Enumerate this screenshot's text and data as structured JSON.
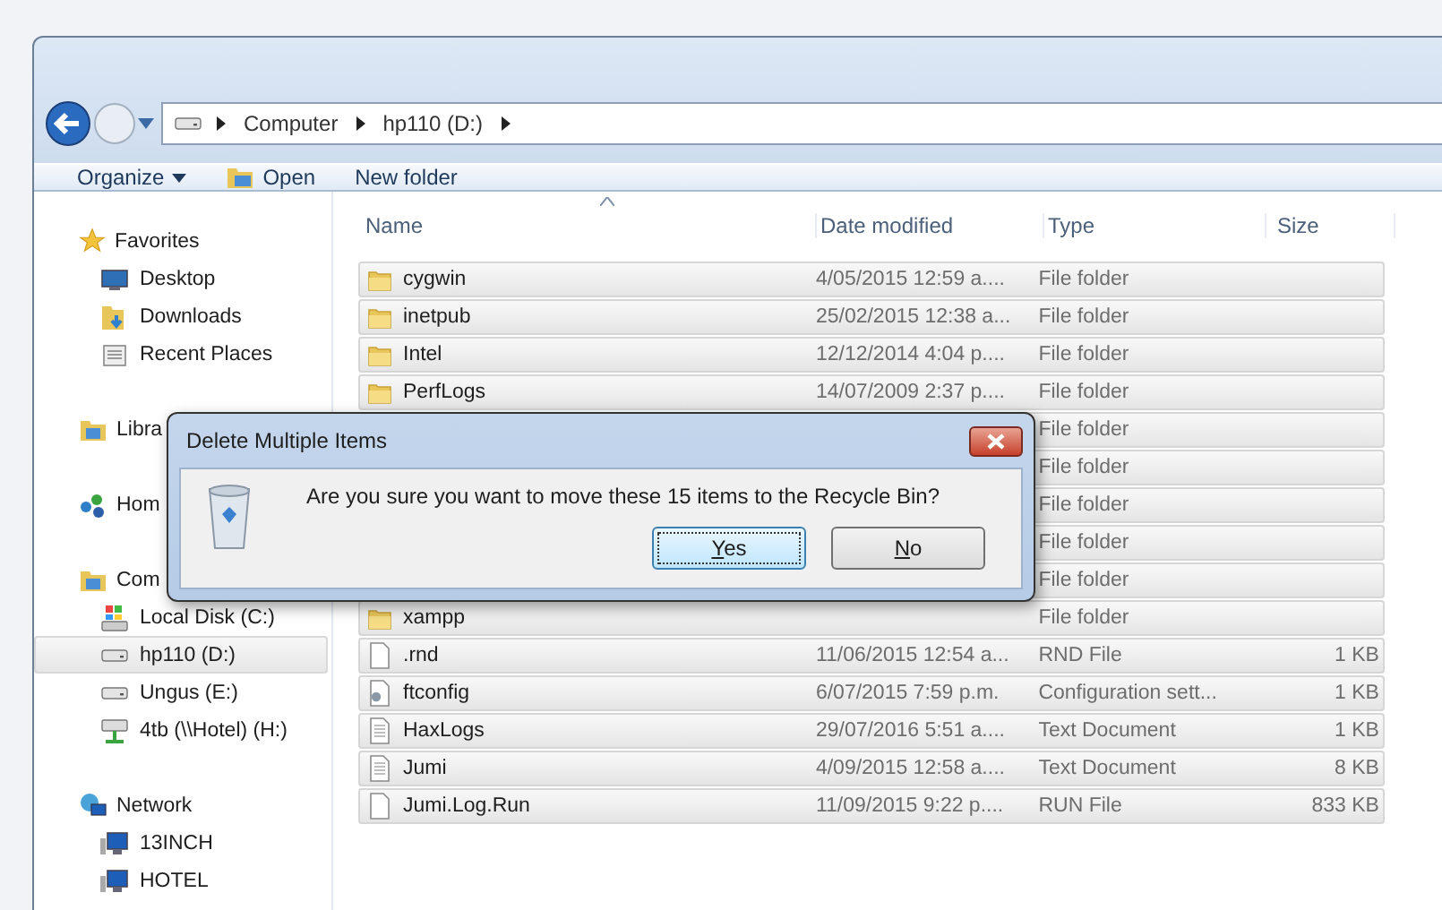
{
  "address": {
    "crumbs": [
      "Computer",
      "hp110 (D:)"
    ]
  },
  "toolbar": [
    "Organize",
    "Open",
    "New folder"
  ],
  "nav": [
    {
      "label": "Favorites",
      "kind": "favorites",
      "children": [
        {
          "label": "Desktop",
          "kind": "desktop",
          "selected": false
        },
        {
          "label": "Downloads",
          "kind": "downloads",
          "selected": false
        },
        {
          "label": "Recent Places",
          "kind": "recent",
          "selected": false
        }
      ]
    },
    {
      "label": "Libra",
      "kind": "libraries"
    },
    {
      "label": "Hom",
      "kind": "homegroup"
    },
    {
      "label": "Com",
      "kind": "computer",
      "children": [
        {
          "label": "Local Disk (C:)",
          "kind": "sysdrive",
          "selected": false
        },
        {
          "label": "hp110 (D:)",
          "kind": "drive",
          "selected": true
        },
        {
          "label": "Ungus (E:)",
          "kind": "drive",
          "selected": false
        },
        {
          "label": "4tb (\\\\Hotel) (H:)",
          "kind": "netdrive",
          "selected": false
        }
      ]
    },
    {
      "label": "Network",
      "kind": "network",
      "children": [
        {
          "label": "13INCH",
          "kind": "pc",
          "selected": false
        },
        {
          "label": "HOTEL",
          "kind": "pc",
          "selected": false
        }
      ]
    }
  ],
  "columns": [
    "Name",
    "Date modified",
    "Type",
    "Size"
  ],
  "rows": [
    {
      "kind": "folder",
      "selected": true,
      "name": "cygwin",
      "date": "4/05/2015 12:59 a....",
      "type": "File folder"
    },
    {
      "kind": "folder",
      "selected": true,
      "name": "inetpub",
      "date": "25/02/2015 12:38 a...",
      "type": "File folder"
    },
    {
      "kind": "folder",
      "selected": true,
      "name": "Intel",
      "date": "12/12/2014 4:04 p....",
      "type": "File folder"
    },
    {
      "kind": "folder",
      "selected": true,
      "name": "PerfLogs",
      "date": "14/07/2009 2:37 p....",
      "type": "File folder"
    },
    {
      "selected": true,
      "type": "File folder"
    },
    {
      "selected": true,
      "type": "File folder"
    },
    {
      "selected": true,
      "type": "File folder"
    },
    {
      "selected": true,
      "type": "File folder"
    },
    {
      "selected": true,
      "type": "File folder"
    },
    {
      "kind": "folder",
      "selected": true,
      "name": "xampp",
      "type": "File folder"
    },
    {
      "kind": "file",
      "selected": true,
      "name": ".rnd",
      "date": "11/06/2015 12:54 a...",
      "type": "RND File",
      "size": "1 KB"
    },
    {
      "kind": "config",
      "selected": true,
      "name": "ftconfig",
      "date": "6/07/2015 7:59 p.m.",
      "type": "Configuration sett...",
      "size": "1 KB"
    },
    {
      "kind": "text",
      "selected": true,
      "name": "HaxLogs",
      "date": "29/07/2016 5:51 a....",
      "type": "Text Document",
      "size": "1 KB"
    },
    {
      "kind": "text",
      "selected": true,
      "name": "Jumi",
      "date": "4/09/2015 12:58 a....",
      "type": "Text Document",
      "size": "8 KB"
    },
    {
      "kind": "file",
      "selected": true,
      "name": "Jumi.Log.Run",
      "date": "11/09/2015 9:22 p....",
      "type": "RUN File",
      "size": "833 KB"
    }
  ],
  "dialog": {
    "title": "Delete Multiple Items",
    "message": "Are you sure you want to move these 15 items to the Recycle Bin?",
    "buttons": [
      {
        "label": "Yes",
        "focused": true
      },
      {
        "label": "No",
        "focused": false
      }
    ]
  }
}
